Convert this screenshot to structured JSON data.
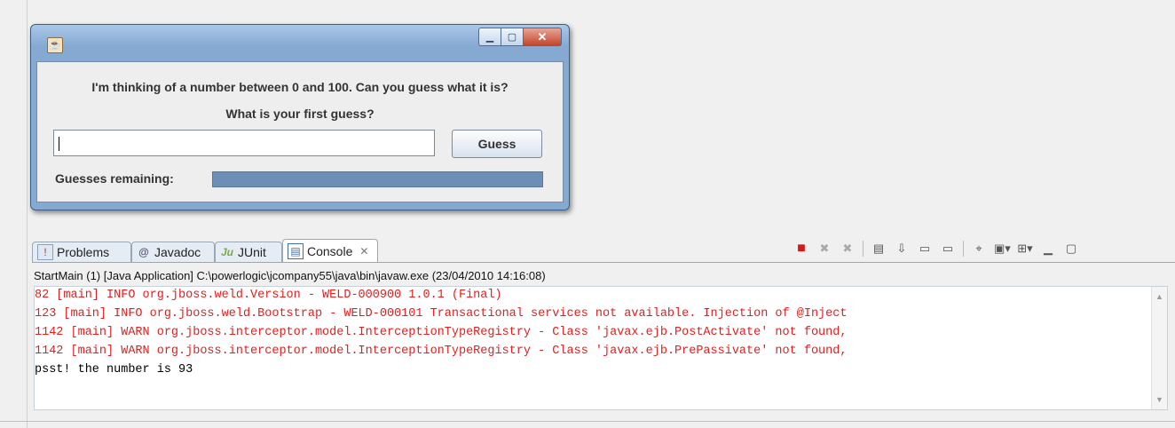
{
  "dialog": {
    "message": "I'm thinking of a number between 0 and 100. Can you guess what it is?",
    "prompt": "What is your first guess?",
    "input_value": "",
    "guess_button": "Guess",
    "remaining_label": "Guesses remaining:",
    "remaining_progress": 1.0,
    "controls": {
      "minimize": "minimize-icon",
      "maximize": "maximize-icon",
      "close": "close-icon"
    }
  },
  "eclipse": {
    "tabs": [
      {
        "label": "Problems",
        "icon": "problems-icon"
      },
      {
        "label": "Javadoc",
        "icon": "at-icon"
      },
      {
        "label": "JUnit",
        "icon": "junit-icon"
      },
      {
        "label": "Console",
        "icon": "console-icon",
        "active": true
      }
    ],
    "console_title": "StartMain (1) [Java Application] C:\\powerlogic\\jcompany55\\java\\bin\\javaw.exe (23/04/2010 14:16:08)",
    "lines": [
      {
        "text": "82 [main] INFO org.jboss.weld.Version - WELD-000900 1.0.1 (Final)",
        "color": "#e02020"
      },
      {
        "text": "123 [main] INFO org.jboss.weld.Bootstrap - WELD-000101 Transactional services not available. Injection of @Inject",
        "color": "#e02020"
      },
      {
        "text": "1142 [main] WARN org.jboss.interceptor.model.InterceptionTypeRegistry - Class 'javax.ejb.PostActivate' not found,",
        "color": "#e02020"
      },
      {
        "text": "1142 [main] WARN org.jboss.interceptor.model.InterceptionTypeRegistry - Class 'javax.ejb.PrePassivate' not found,",
        "color": "#e02020"
      },
      {
        "text": "psst! the number is 93",
        "color": "#000000"
      }
    ]
  }
}
